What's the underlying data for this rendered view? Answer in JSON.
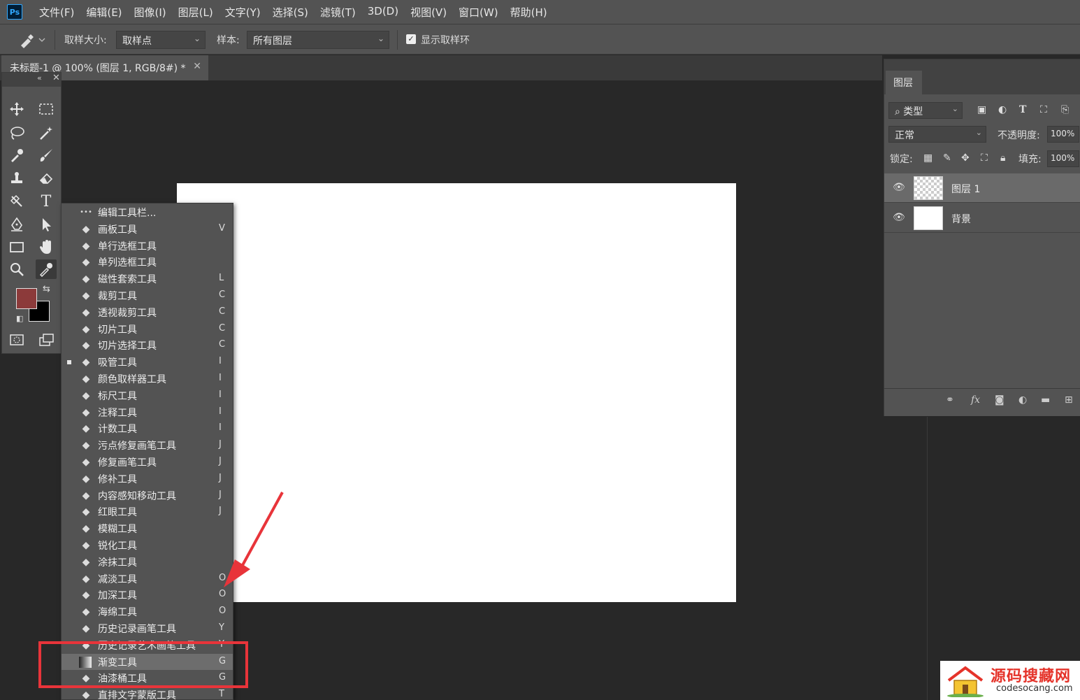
{
  "app": {
    "logo": "Ps"
  },
  "menu": [
    "文件(F)",
    "编辑(E)",
    "图像(I)",
    "图层(L)",
    "文字(Y)",
    "选择(S)",
    "滤镜(T)",
    "3D(D)",
    "视图(V)",
    "窗口(W)",
    "帮助(H)"
  ],
  "options": {
    "sample_size_label": "取样大小:",
    "sample_size_value": "取样点",
    "sample_label": "样本:",
    "sample_value": "所有图层",
    "show_ring_label": "显示取样环",
    "show_ring_checked": true
  },
  "document": {
    "tab_title": "未标题-1 @ 100% (图层 1, RGB/8#) *"
  },
  "colors": {
    "foreground": "#8c3a3a",
    "background": "#000000",
    "annotation": "#e8343a"
  },
  "toolbox_icons": [
    "move-icon",
    "marquee-icon",
    "lasso-icon",
    "magic-wand-icon",
    "eyedropper-icon",
    "brush-icon",
    "stamp-icon",
    "eraser-icon",
    "smudge-icon",
    "type-icon",
    "pen-icon",
    "select-arrow-icon",
    "rectangle-icon",
    "hand-icon",
    "zoom-icon",
    "eyedropper-active-icon"
  ],
  "flyout": [
    {
      "label": "编辑工具栏...",
      "key": "",
      "icon": "ellipsis-icon"
    },
    {
      "label": "画板工具",
      "key": "V",
      "icon": "artboard-icon"
    },
    {
      "label": "单行选框工具",
      "key": "",
      "icon": "row-marquee-icon"
    },
    {
      "label": "单列选框工具",
      "key": "",
      "icon": "column-marquee-icon"
    },
    {
      "label": "磁性套索工具",
      "key": "L",
      "icon": "magnetic-lasso-icon"
    },
    {
      "label": "裁剪工具",
      "key": "C",
      "icon": "crop-icon"
    },
    {
      "label": "透视裁剪工具",
      "key": "C",
      "icon": "perspective-crop-icon"
    },
    {
      "label": "切片工具",
      "key": "C",
      "icon": "slice-icon"
    },
    {
      "label": "切片选择工具",
      "key": "C",
      "icon": "slice-select-icon"
    },
    {
      "label": "吸管工具",
      "key": "I",
      "icon": "eyedropper-icon",
      "current": true
    },
    {
      "label": "颜色取样器工具",
      "key": "I",
      "icon": "color-sampler-icon"
    },
    {
      "label": "标尺工具",
      "key": "I",
      "icon": "ruler-icon"
    },
    {
      "label": "注释工具",
      "key": "I",
      "icon": "note-icon"
    },
    {
      "label": "计数工具",
      "key": "I",
      "icon": "count-icon"
    },
    {
      "label": "污点修复画笔工具",
      "key": "J",
      "icon": "spot-healing-icon"
    },
    {
      "label": "修复画笔工具",
      "key": "J",
      "icon": "healing-brush-icon"
    },
    {
      "label": "修补工具",
      "key": "J",
      "icon": "patch-icon"
    },
    {
      "label": "内容感知移动工具",
      "key": "J",
      "icon": "content-aware-move-icon"
    },
    {
      "label": "红眼工具",
      "key": "J",
      "icon": "red-eye-icon"
    },
    {
      "label": "模糊工具",
      "key": "",
      "icon": "blur-icon"
    },
    {
      "label": "锐化工具",
      "key": "",
      "icon": "sharpen-icon"
    },
    {
      "label": "涂抹工具",
      "key": "",
      "icon": "smudge-icon"
    },
    {
      "label": "减淡工具",
      "key": "O",
      "icon": "dodge-icon"
    },
    {
      "label": "加深工具",
      "key": "O",
      "icon": "burn-icon"
    },
    {
      "label": "海绵工具",
      "key": "O",
      "icon": "sponge-icon"
    },
    {
      "label": "历史记录画笔工具",
      "key": "Y",
      "icon": "history-brush-icon"
    },
    {
      "label": "历史记录艺术画笔工具",
      "key": "Y",
      "icon": "art-history-brush-icon"
    },
    {
      "label": "渐变工具",
      "key": "G",
      "icon": "gradient-icon",
      "highlighted": true
    },
    {
      "label": "油漆桶工具",
      "key": "G",
      "icon": "paint-bucket-icon"
    },
    {
      "label": "直排文字蒙版工具",
      "key": "T",
      "icon": "vertical-type-mask-icon"
    }
  ],
  "layers_panel": {
    "tab": "图层",
    "filter_label": "类型",
    "blend_mode": "正常",
    "opacity_label": "不透明度:",
    "opacity_value": "100%",
    "lock_label": "锁定:",
    "fill_label": "填充:",
    "fill_value": "100%",
    "layers": [
      {
        "name": "图层 1",
        "selected": true,
        "transparent": true
      },
      {
        "name": "背景",
        "selected": false,
        "transparent": false
      }
    ],
    "footer_fx": "fx"
  },
  "watermark": {
    "title": "源码搜藏网",
    "url": "codesocang.com"
  }
}
